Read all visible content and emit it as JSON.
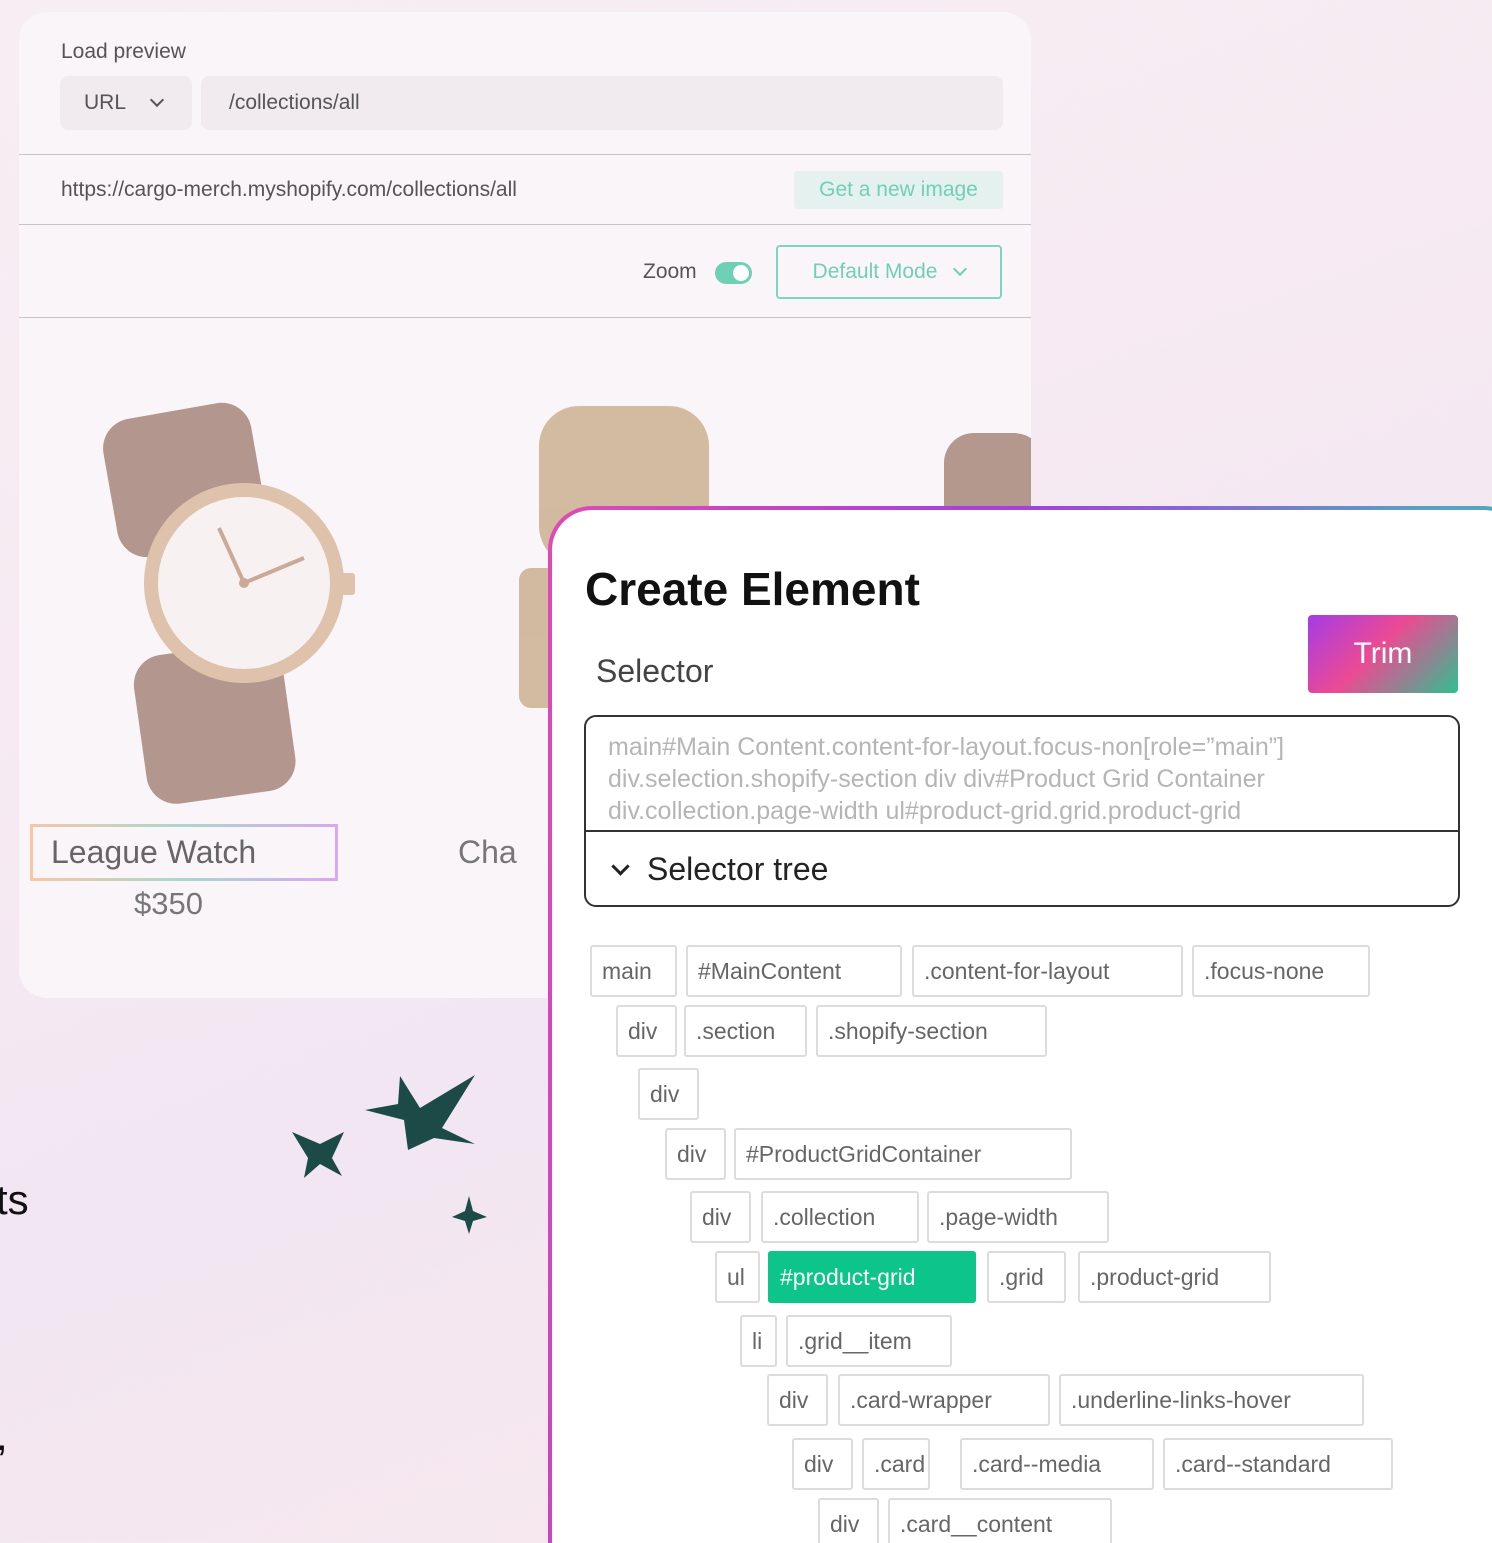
{
  "preview": {
    "load_label": "Load preview",
    "url_type": "URL",
    "path_value": "/collections/all",
    "full_url": "https://cargo-merch.myshopify.com/collections/all",
    "new_image_label": "Get a new image",
    "zoom_label": "Zoom",
    "zoom_on": true,
    "mode_label": "Default Mode",
    "products": [
      {
        "name": "League Watch",
        "price": "$350"
      },
      {
        "name": "Cha"
      }
    ]
  },
  "background_text": [
    "ts",
    ","
  ],
  "create_element": {
    "title": "Create Element",
    "selector_label": "Selector",
    "trim_label": "Trim",
    "selector_lines": [
      "main#Main Content.content-for-layout.focus-non[role=”main”]",
      "div.selection.shopify-section div div#Product Grid Container",
      "div.collection.page-width ul#product-grid.grid.product-grid"
    ],
    "tree_label": "Selector tree",
    "tree": [
      [
        "main",
        "#MainContent",
        ".content-for-layout",
        ".focus-none"
      ],
      [
        "div",
        ".section",
        ".shopify-section"
      ],
      [
        "div"
      ],
      [
        "div",
        "#ProductGridContainer"
      ],
      [
        "div",
        ".collection",
        ".page-width"
      ],
      [
        "ul",
        "#product-grid",
        ".grid",
        ".product-grid"
      ],
      [
        "li",
        ".grid__item"
      ],
      [
        "div",
        ".card-wrapper",
        ".underline-links-hover"
      ],
      [
        "div",
        ".card",
        ".card--media",
        ".card--standard"
      ],
      [
        "div",
        ".card__content"
      ]
    ],
    "active_chip": "#product-grid"
  },
  "colors": {
    "accent_teal": "#6fd0b6",
    "active_chip": "#0dc48a",
    "sparkle": "#1c4b47"
  }
}
